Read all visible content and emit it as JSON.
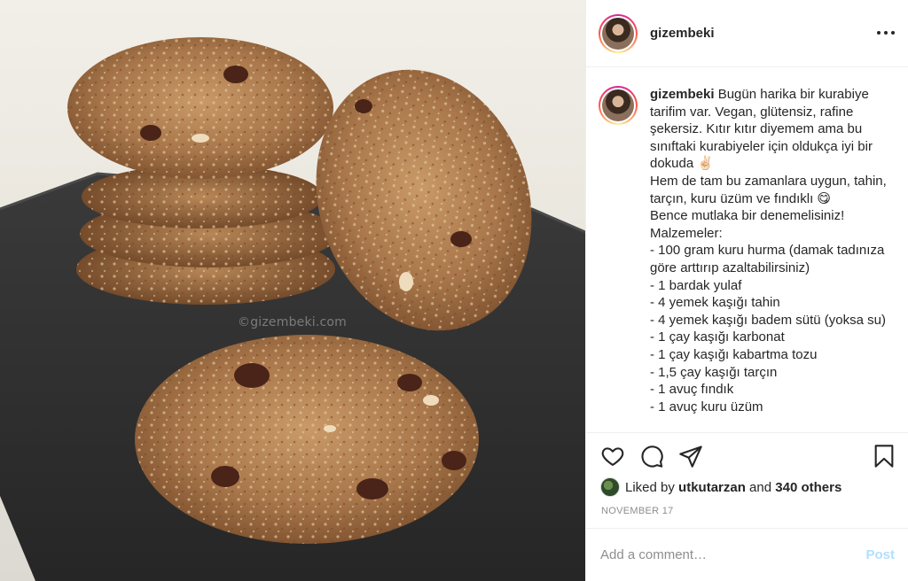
{
  "photo": {
    "alt": "Cookies on a slate plate",
    "watermark": "©gizembeki.com"
  },
  "header": {
    "username": "gizembeki",
    "more_icon": "more-horizontal-icon"
  },
  "caption": {
    "username": "gizembeki",
    "text": " Bugün harika bir kurabiye tarifim var. Vegan, glütensiz, rafine şekersiz. Kıtır kıtır diyemem ama bu sınıftaki kurabiyeler için oldukça iyi bir dokuda ✌🏻\nHem de tam bu zamanlara uygun, tahin, tarçın, kuru üzüm ve fındıklı 😋\nBence mutlaka bir denemelisiniz!\nMalzemeler:\n- 100 gram kuru hurma (damak tadınıza göre arttırıp azaltabilirsiniz)\n- 1 bardak yulaf\n- 4 yemek kaşığı tahin\n- 4 yemek kaşığı badem sütü (yoksa su)\n- 1 çay kaşığı karbonat\n- 1 çay kaşığı kabartma tozu\n- 1,5 çay kaşığı tarçın\n- 1 avuç fındık\n- 1 avuç kuru üzüm"
  },
  "actions": {
    "icons": [
      "heart-icon",
      "comment-icon",
      "share-icon",
      "bookmark-icon"
    ]
  },
  "likes": {
    "prefix": "Liked by ",
    "user": "utkutarzan",
    "middle": " and ",
    "others": "340 others"
  },
  "date": "NOVEMBER 17",
  "comment": {
    "placeholder": "Add a comment…",
    "post_label": "Post",
    "post_color": "#b2dffc"
  }
}
